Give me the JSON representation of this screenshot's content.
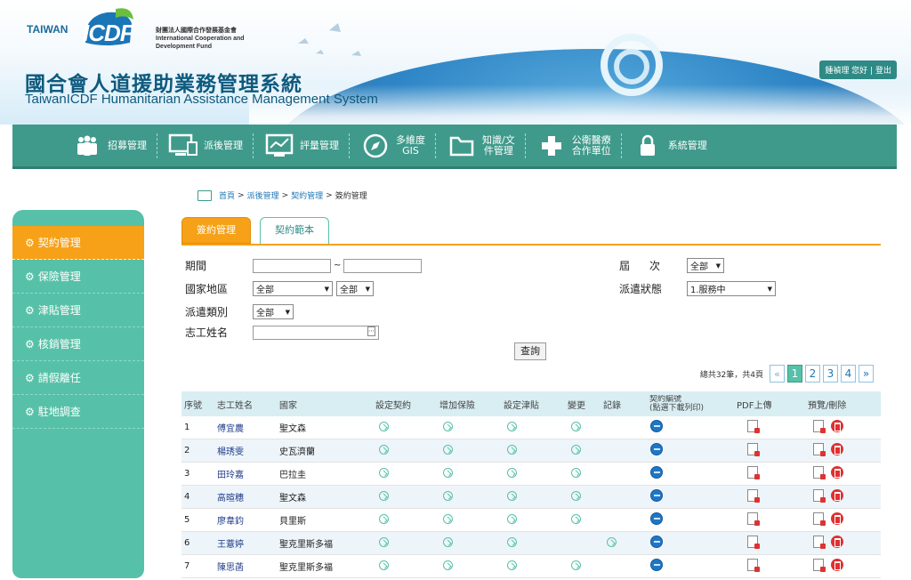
{
  "header": {
    "logo_taiwan": "TAIWAN",
    "logo_icdf": "ICDF",
    "org_zh": "財團法人國際合作發展基金會",
    "org_en1": "International Cooperation and",
    "org_en2": "Development Fund",
    "title_zh": "國合會人道援助業務管理系統",
    "title_en": "TaiwanICDF Humanitarian Assistance Management System",
    "user_greeting": "鍾禎理 您好",
    "sep": "|",
    "logout": "登出"
  },
  "nav": {
    "items": [
      {
        "label": "招募管理",
        "icon": "people-icon"
      },
      {
        "label": "派後管理",
        "icon": "monitor-icon"
      },
      {
        "label": "評量管理",
        "icon": "chart-screen-icon"
      },
      {
        "label1": "多維度",
        "label2": "GIS",
        "icon": "compass-icon"
      },
      {
        "label1": "知識/文",
        "label2": "件管理",
        "icon": "folder-icon"
      },
      {
        "label1": "公衛醫療",
        "label2": "合作單位",
        "icon": "medical-cross-icon"
      },
      {
        "label": "系統管理",
        "icon": "lock-icon"
      }
    ]
  },
  "breadcrumb": {
    "home": "首頁",
    "sep": ">",
    "level1": "派後管理",
    "level2": "契約管理",
    "current": "簽約管理"
  },
  "sidebar": {
    "items": [
      {
        "label": "契約管理",
        "active": true
      },
      {
        "label": "保險管理"
      },
      {
        "label": "津貼管理"
      },
      {
        "label": "核銷管理"
      },
      {
        "label": "請假離任"
      },
      {
        "label": "駐地調查"
      }
    ]
  },
  "tabs": {
    "active": "簽約管理",
    "inactive": "契約範本"
  },
  "filters": {
    "period_label": "期間",
    "period_sep": "~",
    "period_from": "",
    "period_to": "",
    "country_label": "國家地區",
    "country_value": "全部",
    "country_sub_value": "全部",
    "type_label": "派遣類別",
    "type_value": "全部",
    "name_label": "志工姓名",
    "name_value": "",
    "term_label_1": "屆",
    "term_label_2": "次",
    "term_value": "全部",
    "status_label": "派遣狀態",
    "status_value": "1.服務中",
    "search_button": "查詢"
  },
  "pager": {
    "info": "總共32筆，共4頁",
    "prev": "«",
    "next": "»",
    "pages": [
      "1",
      "2",
      "3",
      "4"
    ],
    "current": "1"
  },
  "table": {
    "headers": {
      "no": "序號",
      "name": "志工姓名",
      "country": "國家",
      "set_contract": "設定契約",
      "add_insurance": "增加保險",
      "set_allowance": "設定津貼",
      "change": "變更",
      "record": "記錄",
      "contract_no_1": "契約編號",
      "contract_no_2": "(點選下載列印)",
      "pdf_upload": "PDF上傳",
      "preview_delete": "預覽/刪除"
    },
    "rows": [
      {
        "no": "1",
        "name": "傅宜農",
        "country": "聖文森",
        "c": true,
        "i": true,
        "a": true,
        "chg": true,
        "rec": false
      },
      {
        "no": "2",
        "name": "楊琇雯",
        "country": "史瓦濟蘭",
        "c": true,
        "i": true,
        "a": true,
        "chg": true,
        "rec": false
      },
      {
        "no": "3",
        "name": "田玲嘉",
        "country": "巴拉圭",
        "c": true,
        "i": true,
        "a": true,
        "chg": true,
        "rec": false
      },
      {
        "no": "4",
        "name": "高暄穗",
        "country": "聖文森",
        "c": true,
        "i": true,
        "a": true,
        "chg": true,
        "rec": false
      },
      {
        "no": "5",
        "name": "廖韋鈞",
        "country": "貝里斯",
        "c": true,
        "i": true,
        "a": true,
        "chg": true,
        "rec": false
      },
      {
        "no": "6",
        "name": "王薏婷",
        "country": "聖克里斯多福",
        "c": true,
        "i": true,
        "a": true,
        "chg": false,
        "rec": true
      },
      {
        "no": "7",
        "name": "陳思菡",
        "country": "聖克里斯多福",
        "c": true,
        "i": true,
        "a": true,
        "chg": true,
        "rec": false
      }
    ]
  }
}
